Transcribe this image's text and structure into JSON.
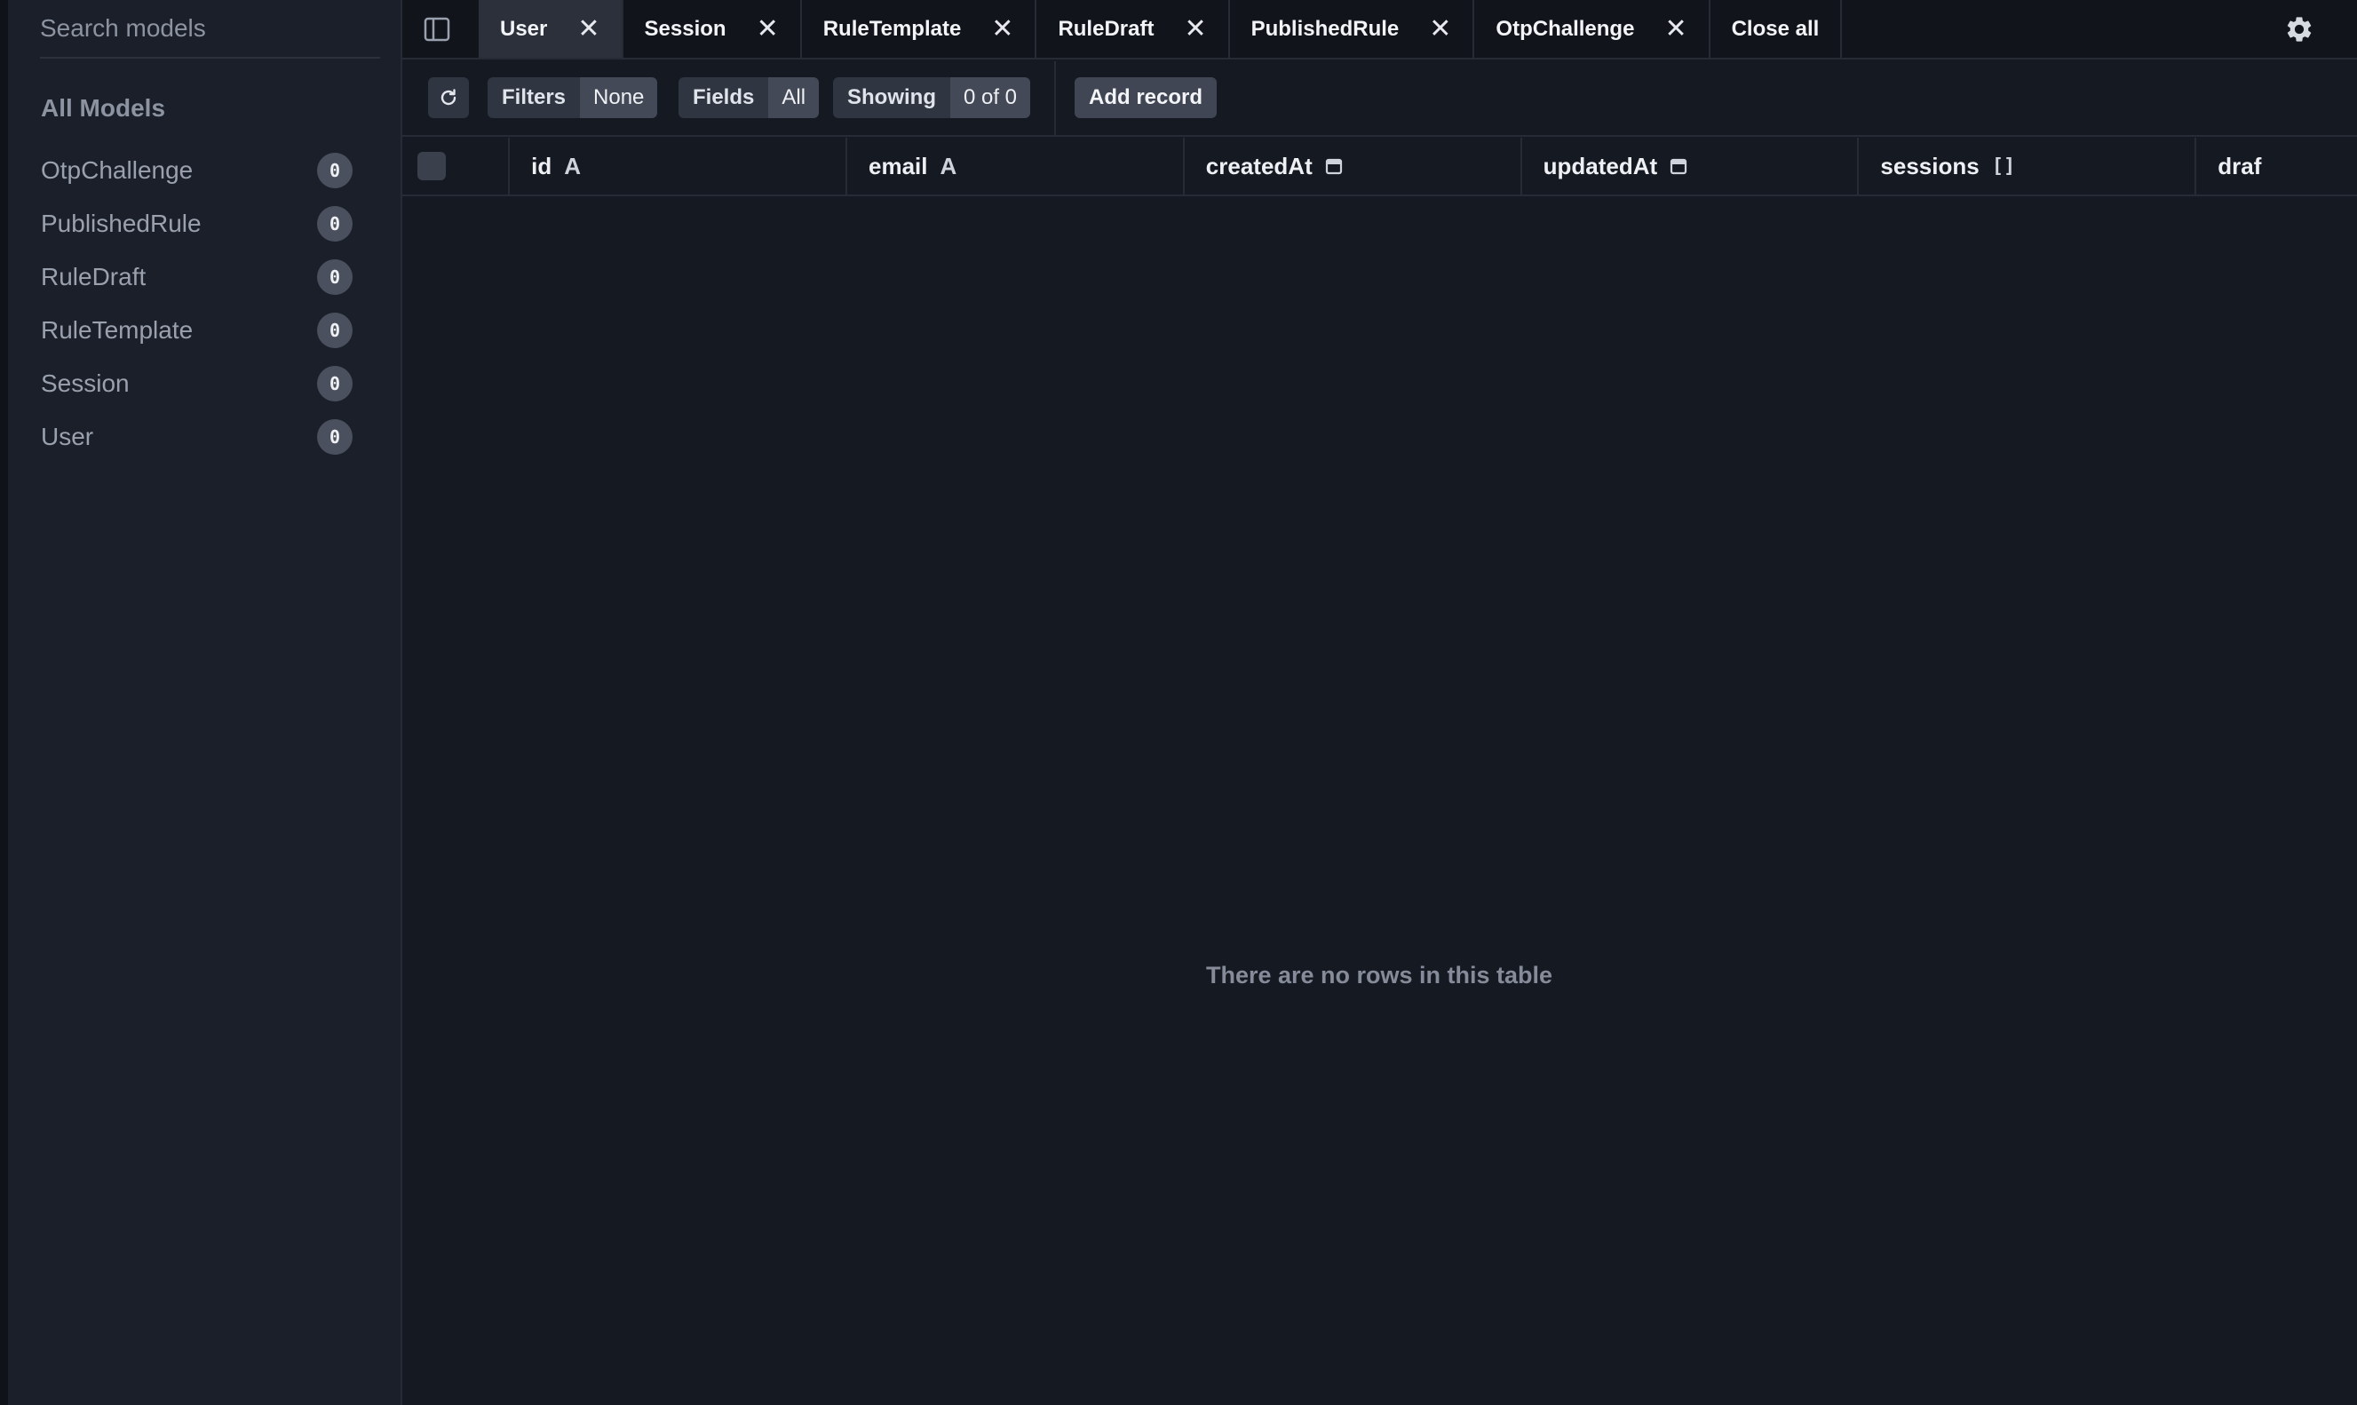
{
  "sidebar": {
    "search_placeholder": "Search models",
    "heading": "All Models",
    "models": [
      {
        "name": "OtpChallenge",
        "count": "0"
      },
      {
        "name": "PublishedRule",
        "count": "0"
      },
      {
        "name": "RuleDraft",
        "count": "0"
      },
      {
        "name": "RuleTemplate",
        "count": "0"
      },
      {
        "name": "Session",
        "count": "0"
      },
      {
        "name": "User",
        "count": "0"
      }
    ]
  },
  "tabs": [
    {
      "label": "User",
      "active": true
    },
    {
      "label": "Session"
    },
    {
      "label": "RuleTemplate"
    },
    {
      "label": "RuleDraft"
    },
    {
      "label": "PublishedRule"
    },
    {
      "label": "OtpChallenge"
    }
  ],
  "close_all_label": "Close all",
  "toolbar": {
    "filters_label": "Filters",
    "filters_value": "None",
    "fields_label": "Fields",
    "fields_value": "All",
    "showing_label": "Showing",
    "showing_value": "0 of 0",
    "add_record_label": "Add record"
  },
  "columns": [
    {
      "name": "id",
      "type_icon": "A"
    },
    {
      "name": "email",
      "type_icon": "A"
    },
    {
      "name": "createdAt",
      "type_icon": "calendar-icon"
    },
    {
      "name": "updatedAt",
      "type_icon": "calendar-icon"
    },
    {
      "name": "sessions",
      "type_icon": "[]"
    },
    {
      "name": "draf",
      "type_icon": ""
    }
  ],
  "empty_message": "There are no rows in this table",
  "colors": {
    "background": "#151922",
    "sidebar": "#1b1f29",
    "active_tab": "#2b303b",
    "badge": "#4a505d"
  }
}
